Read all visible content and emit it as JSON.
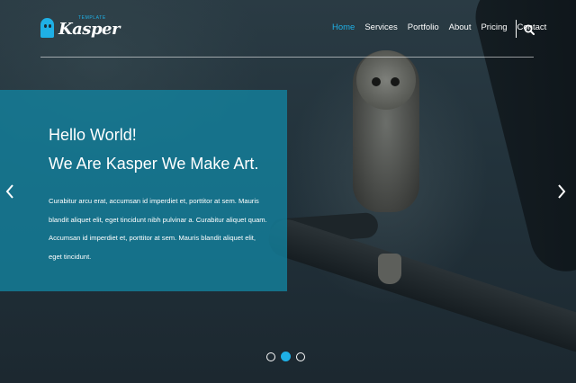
{
  "logo": {
    "small_text": "TEMPLATE",
    "main_text": "Kasper",
    "icon": "ghost-icon"
  },
  "nav": {
    "items": [
      {
        "label": "Home",
        "active": true
      },
      {
        "label": "Services",
        "active": false
      },
      {
        "label": "Portfolio",
        "active": false
      },
      {
        "label": "About",
        "active": false
      },
      {
        "label": "Pricing",
        "active": false
      },
      {
        "label": "Contact",
        "active": false
      }
    ],
    "search_icon": "search-icon"
  },
  "hero": {
    "heading_line1": "Hello World!",
    "heading_line2": "We Are Kasper We Make Art.",
    "body": "Curabitur arcu erat, accumsan id imperdiet et, porttitor at sem. Mauris blandit aliquet elit, eget tincidunt nibh pulvinar a. Curabitur aliquet quam. Accumsan id imperdiet et, porttitor at sem. Mauris blandit aliquet elit, eget tincidunt.",
    "prev_icon": "chevron-left-icon",
    "next_icon": "chevron-right-icon"
  },
  "slider": {
    "slide_count": 3,
    "active_index": 1
  },
  "colors": {
    "accent": "#1fb0e6",
    "panel": "#13809c",
    "text": "#ffffff"
  }
}
